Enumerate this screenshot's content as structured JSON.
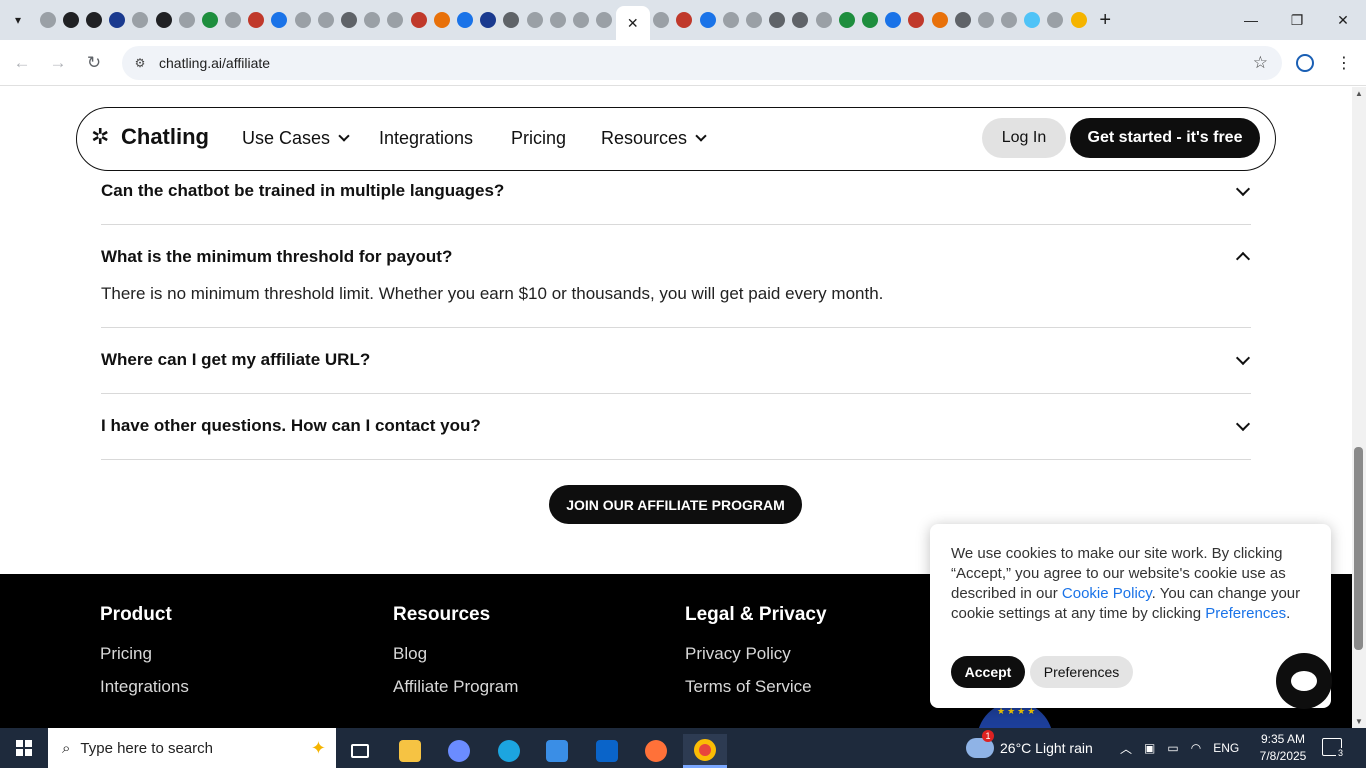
{
  "browser": {
    "url": "chatling.ai/affiliate",
    "tab_close_glyph": "✕",
    "new_tab_glyph": "+",
    "favicon_colors": [
      "#9aa0a6",
      "#202124",
      "#202124",
      "#1a3a8f",
      "#9aa0a6",
      "#202124",
      "#9aa0a6",
      "#1e8e3e",
      "#9aa0a6",
      "#c0392b",
      "#1a73e8",
      "#9aa0a6",
      "#9aa0a6",
      "#5f6368",
      "#9aa0a6",
      "#9aa0a6",
      "#c0392b",
      "#e8710a",
      "#1a73e8",
      "#1a3a8f",
      "#5f6368",
      "#9aa0a6",
      "#9aa0a6",
      "#9aa0a6",
      "#9aa0a6"
    ],
    "favicon_colors_right": [
      "#9aa0a6",
      "#c0392b",
      "#1a73e8",
      "#9aa0a6",
      "#9aa0a6",
      "#5f6368",
      "#5f6368",
      "#9aa0a6",
      "#1e8e3e",
      "#1e8e3e",
      "#1a73e8",
      "#c0392b",
      "#e8710a",
      "#5f6368",
      "#9aa0a6",
      "#9aa0a6",
      "#4fc3f7",
      "#9aa0a6",
      "#f5b400"
    ]
  },
  "site": {
    "logo_text": "Chatling",
    "nav": {
      "use_cases": "Use Cases",
      "integrations": "Integrations",
      "pricing": "Pricing",
      "resources": "Resources"
    },
    "login": "Log In",
    "cta": "Get started - it's free"
  },
  "faq": [
    {
      "question": "Can the chatbot be trained in multiple languages?",
      "expanded": false
    },
    {
      "question": "What is the minimum threshold for payout?",
      "expanded": true,
      "answer": "There is no minimum threshold limit. Whether you earn $10 or thousands, you will get paid every month."
    },
    {
      "question": "Where can I get my affiliate URL?",
      "expanded": false
    },
    {
      "question": "I have other questions. How can I contact you?",
      "expanded": false
    }
  ],
  "join_button": "JOIN OUR AFFILIATE PROGRAM",
  "footer": {
    "product": {
      "heading": "Product",
      "links": [
        "Pricing",
        "Integrations"
      ]
    },
    "resources": {
      "heading": "Resources",
      "links": [
        "Blog",
        "Affiliate Program"
      ]
    },
    "legal": {
      "heading": "Legal & Privacy",
      "links": [
        "Privacy Policy",
        "Terms of Service"
      ]
    }
  },
  "cookie": {
    "text_1": "We use cookies to make our site work. By clicking “Accept,” you agree to our website's cookie use as described in our ",
    "link_1": "Cookie Policy",
    "text_2": ". You can change your cookie settings at any time by clicking ",
    "link_2": "Preferences",
    "text_3": ".",
    "accept": "Accept",
    "preferences": "Preferences"
  },
  "taskbar": {
    "search_placeholder": "Type here to search",
    "weather_badge": "1",
    "weather": "26°C  Light rain",
    "language": "ENG",
    "time": "9:35 AM",
    "date": "7/8/2025",
    "notifications": "3"
  }
}
